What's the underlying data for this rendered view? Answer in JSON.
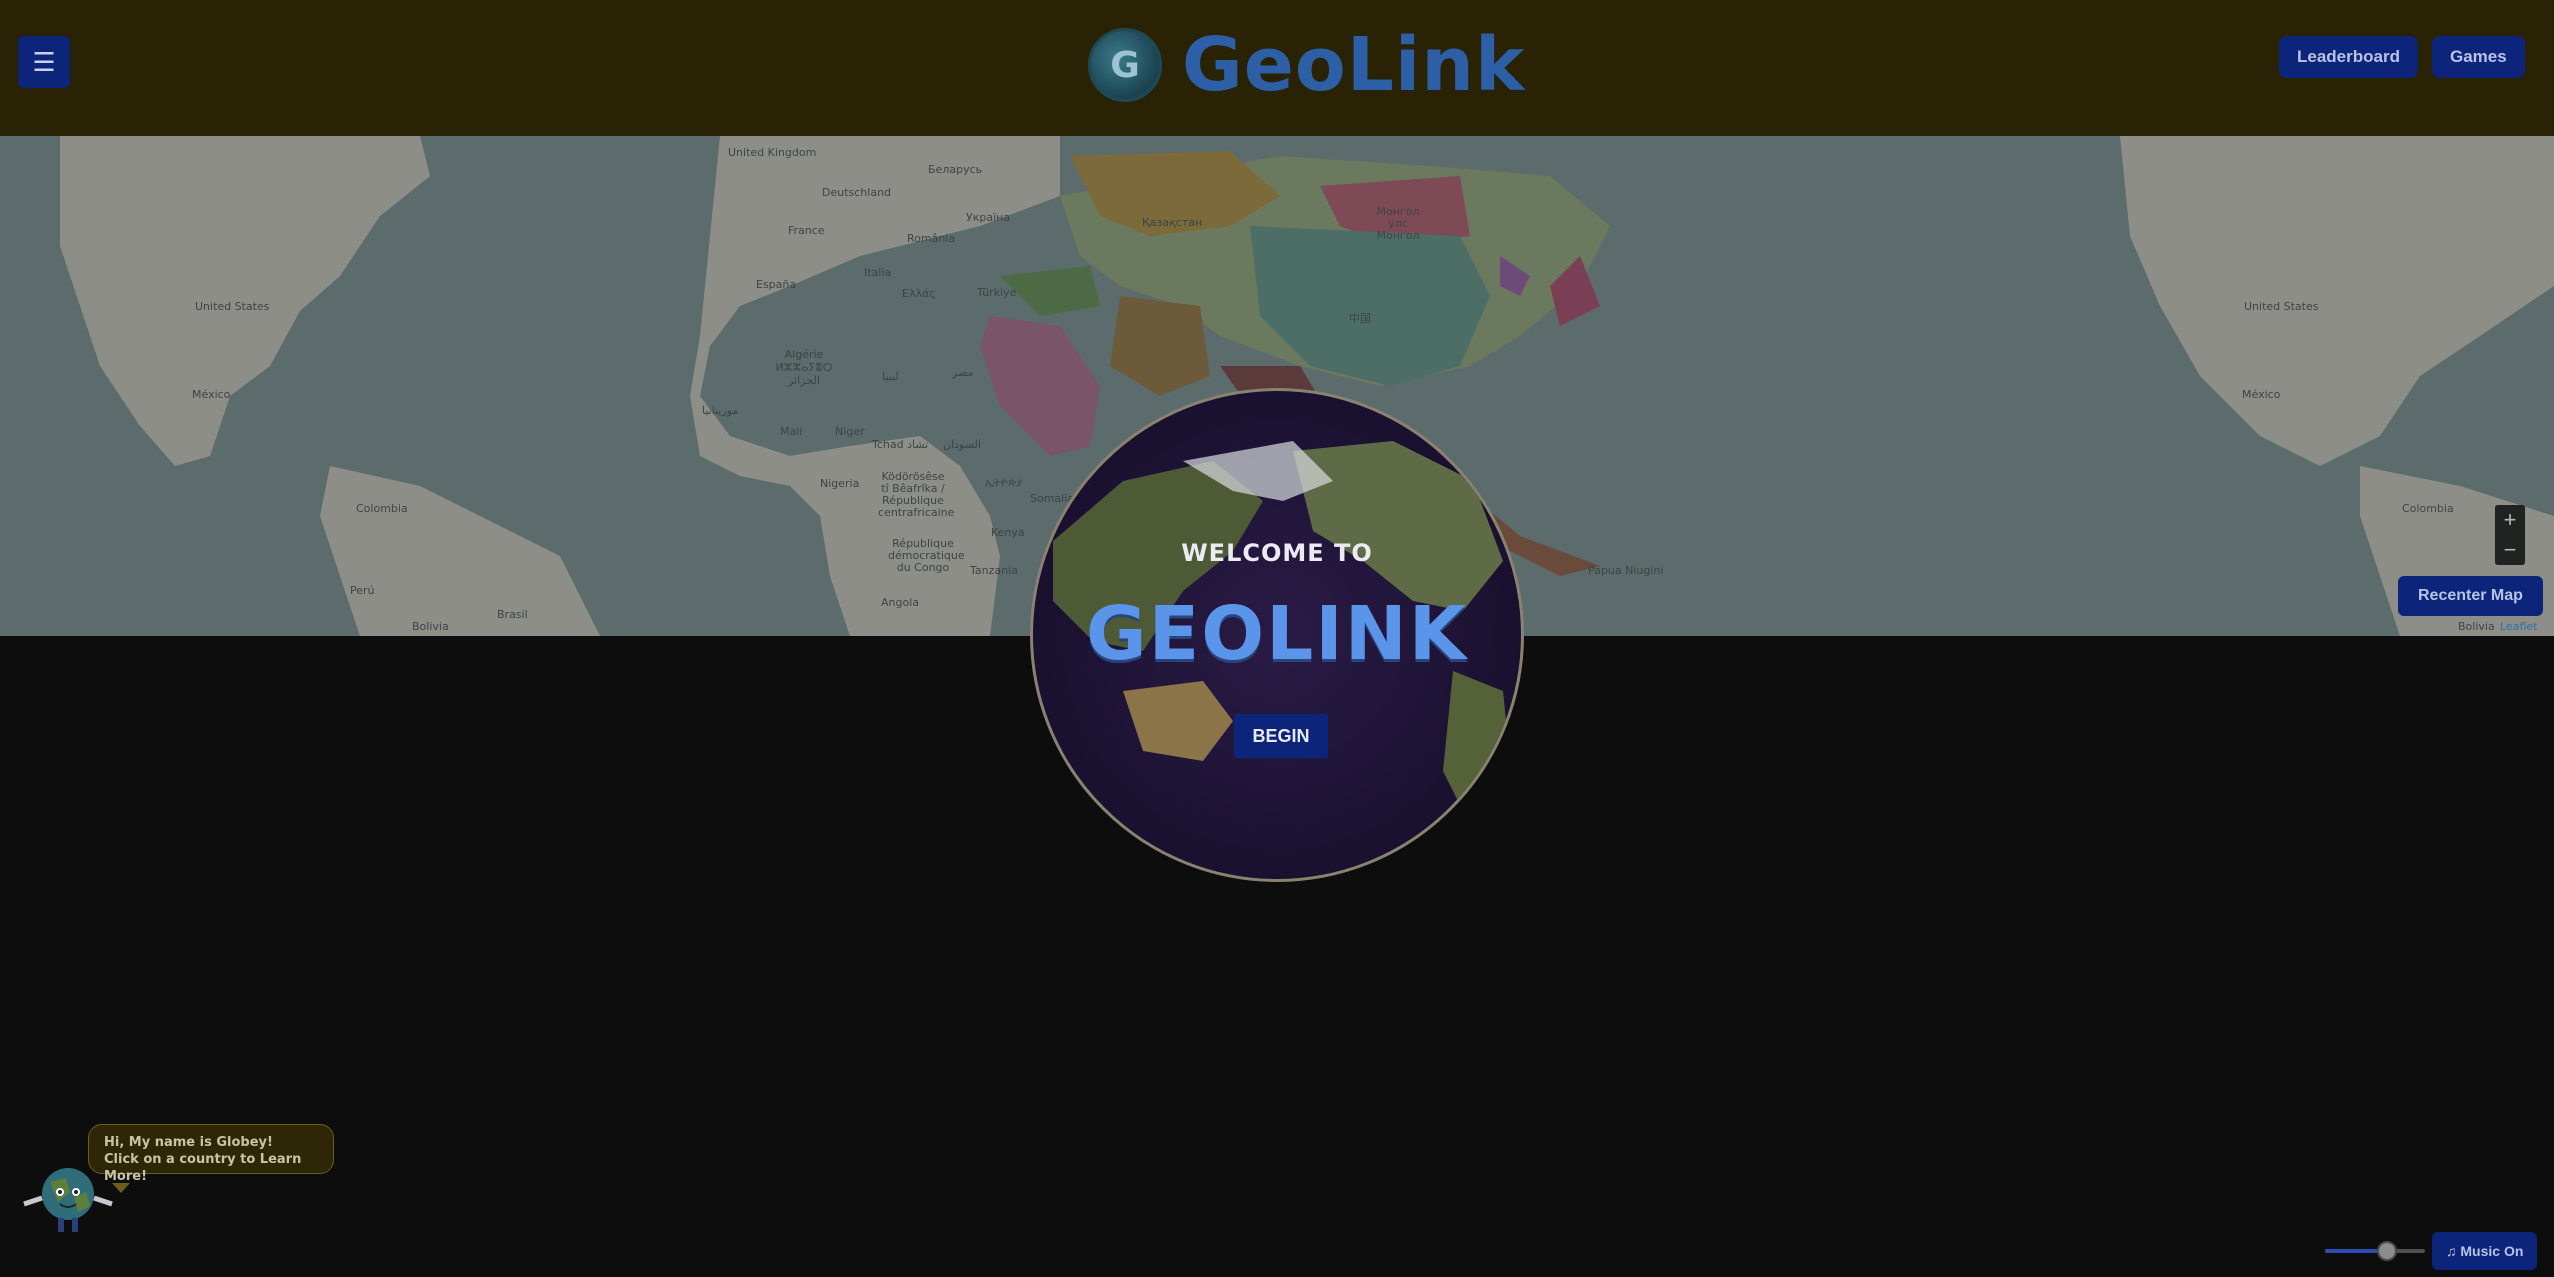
{
  "header": {
    "menu_icon": "☰",
    "logo_letter": "G",
    "logo_text": "GeoLink",
    "leaderboard_label": "Leaderboard",
    "games_label": "Games"
  },
  "map": {
    "labels": [
      "United Kingdom",
      "Беларусь",
      "Deutschland",
      "Україна",
      "France",
      "România",
      "Italia",
      "España",
      "Türkiye",
      "Ελλάς",
      "Algérie ⵍⵣⵣⴰⵢⴻⵔ الجزائر",
      "ليبيا",
      "مصر",
      "موريتانيا",
      "Mali",
      "Niger",
      "Tchad تشاد",
      "السودان",
      "Nigeria",
      "Ködörösêse tî Bêafrîka / République centrafricaine",
      "ኢትዮጵያ",
      "Kenya",
      "République démocratique du Congo",
      "Tanzania",
      "Angola",
      "Somalia",
      "Қазақстан",
      "Монгол улс Монгол",
      "中国",
      "United States",
      "México",
      "Colombia",
      "Perú",
      "Brasil",
      "Bolivia",
      "Papua Niugini",
      "United States",
      "México",
      "Colombia",
      "Bolivia"
    ],
    "zoom_in": "+",
    "zoom_out": "−",
    "recenter_label": "Recenter Map",
    "attribution": "Leaflet"
  },
  "welcome": {
    "subtitle": "WELCOME TO",
    "title": "GEOLINK",
    "begin_label": "BEGIN"
  },
  "mascot": {
    "line1": "Hi, My name is Globey!",
    "line2": "Click on a country to Learn More!"
  },
  "music": {
    "volume": 0.62,
    "button_icon": "♫",
    "button_label": "Music On"
  }
}
